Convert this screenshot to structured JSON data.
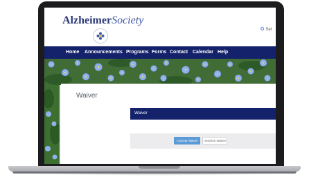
{
  "brand": {
    "name_part1": "Alzheimer",
    "name_part2": "Society"
  },
  "translate": {
    "label": "Sel"
  },
  "nav": {
    "items": [
      {
        "label": "Home"
      },
      {
        "label": "Announcements"
      },
      {
        "label": "Programs"
      },
      {
        "label": "Forms"
      },
      {
        "label": "Contact"
      },
      {
        "label": "Calendar"
      },
      {
        "label": "Help"
      }
    ]
  },
  "page": {
    "title": "Waiver"
  },
  "waiver": {
    "header": "Waiver",
    "accept_label": "I Accept Waiver",
    "decline_label": "I Decline Waiver"
  },
  "colors": {
    "nav_bg": "#14226b",
    "accept_button": "#5a9ad6",
    "brand_text": "#2b3a78",
    "flower_blue": "#7fa6e3"
  },
  "icons": {
    "logo": "forget-me-not-emblem-icon",
    "translate": "google-g-icon"
  }
}
